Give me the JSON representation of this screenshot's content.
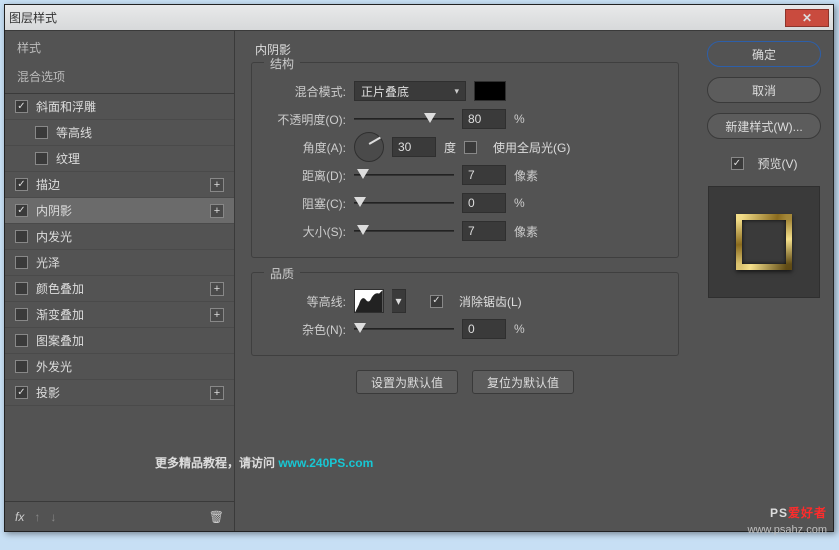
{
  "window": {
    "title": "图层样式",
    "close": "✕"
  },
  "leftPanel": {
    "heading": "样式",
    "subheading": "混合选项",
    "items": [
      {
        "label": "斜面和浮雕",
        "checked": true,
        "indent": 0,
        "plus": false
      },
      {
        "label": "等高线",
        "checked": false,
        "indent": 1,
        "plus": false
      },
      {
        "label": "纹理",
        "checked": false,
        "indent": 1,
        "plus": false
      },
      {
        "label": "描边",
        "checked": true,
        "indent": 0,
        "plus": true
      },
      {
        "label": "内阴影",
        "checked": true,
        "indent": 0,
        "plus": true,
        "selected": true
      },
      {
        "label": "内发光",
        "checked": false,
        "indent": 0,
        "plus": false
      },
      {
        "label": "光泽",
        "checked": false,
        "indent": 0,
        "plus": false
      },
      {
        "label": "颜色叠加",
        "checked": false,
        "indent": 0,
        "plus": true
      },
      {
        "label": "渐变叠加",
        "checked": false,
        "indent": 0,
        "plus": true
      },
      {
        "label": "图案叠加",
        "checked": false,
        "indent": 0,
        "plus": false
      },
      {
        "label": "外发光",
        "checked": false,
        "indent": 0,
        "plus": false
      },
      {
        "label": "投影",
        "checked": true,
        "indent": 0,
        "plus": true
      }
    ],
    "footer": {
      "fx": "fx",
      "plusIcon": "+"
    }
  },
  "center": {
    "title": "内阴影",
    "structure": {
      "legend": "结构",
      "blendMode": {
        "label": "混合模式:",
        "value": "正片叠底",
        "color": "#000000"
      },
      "opacity": {
        "label": "不透明度(O):",
        "value": "80",
        "unit": "%",
        "thumb": 70
      },
      "angle": {
        "label": "角度(A):",
        "value": "30",
        "degree": "度",
        "globalLabel": "使用全局光(G)",
        "globalChecked": false
      },
      "distance": {
        "label": "距离(D):",
        "value": "7",
        "unit": "像素",
        "thumb": 3
      },
      "choke": {
        "label": "阻塞(C):",
        "value": "0",
        "unit": "%",
        "thumb": 0
      },
      "size": {
        "label": "大小(S):",
        "value": "7",
        "unit": "像素",
        "thumb": 3
      }
    },
    "quality": {
      "legend": "品质",
      "contour": {
        "label": "等高线:",
        "antiAliasLabel": "消除锯齿(L)",
        "antiAliasChecked": true
      },
      "noise": {
        "label": "杂色(N):",
        "value": "0",
        "unit": "%",
        "thumb": 0
      }
    },
    "buttons": {
      "setDefault": "设置为默认值",
      "resetDefault": "复位为默认值"
    }
  },
  "right": {
    "ok": "确定",
    "cancel": "取消",
    "newStyle": "新建样式(W)...",
    "preview": {
      "label": "预览(V)",
      "checked": true
    }
  },
  "overlay": {
    "promoText": "更多精品教程，请访问 ",
    "promoLink": "www.240PS.com",
    "wm1a": "PS",
    "wm1b": "爱好者",
    "wm2": "www.psahz.com"
  }
}
